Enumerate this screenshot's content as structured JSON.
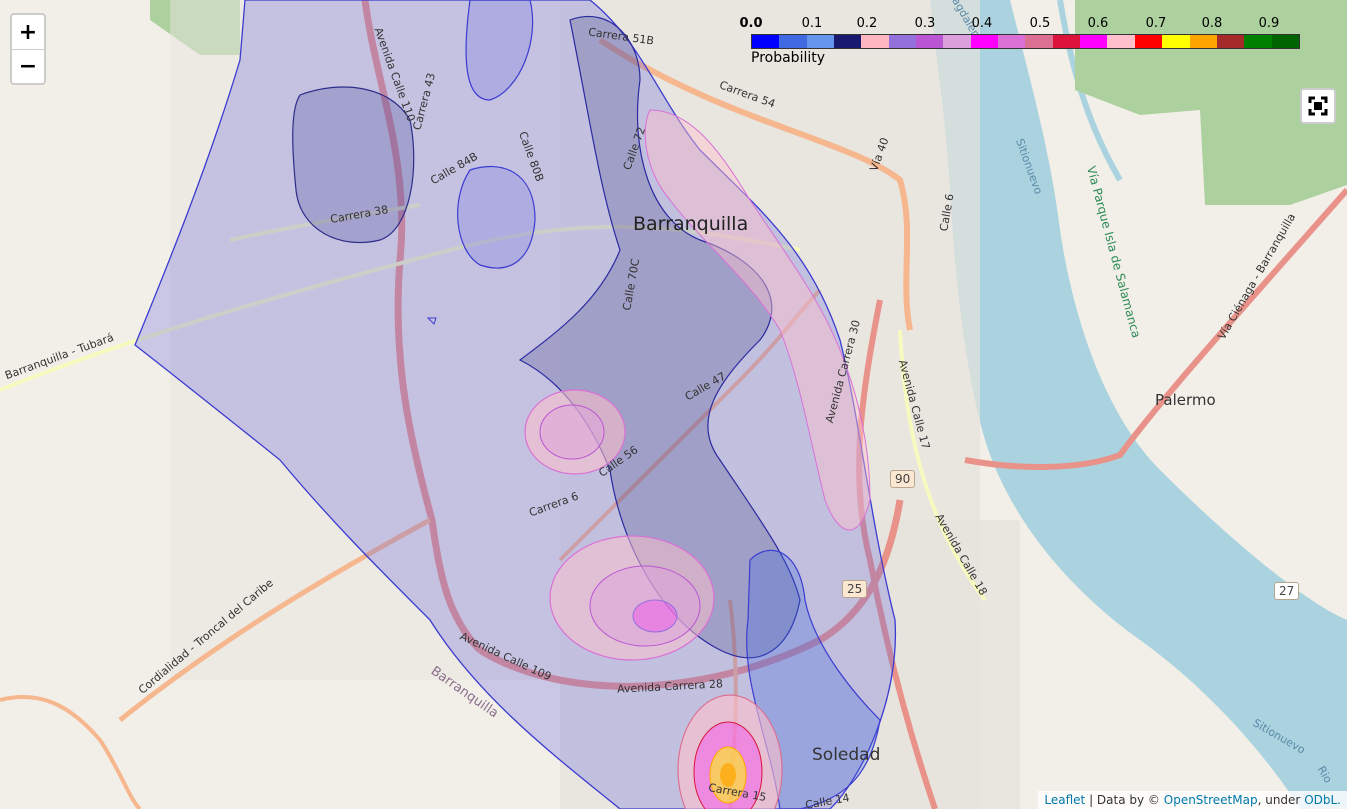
{
  "controls": {
    "zoom_in": "+",
    "zoom_out": "−",
    "fullscreen_icon": "fullscreen-icon"
  },
  "legend": {
    "ticks": [
      "0.0",
      "0.1",
      "0.2",
      "0.3",
      "0.4",
      "0.5",
      "0.6",
      "0.7",
      "0.8",
      "0.9"
    ],
    "caption": "Probability",
    "colors": [
      "#0000ff",
      "#4169e1",
      "#6495ed",
      "#191970",
      "#ffb6c1",
      "#9370db",
      "#ba55d3",
      "#dda0dd",
      "#ff00ff",
      "#da70d6",
      "#db7093",
      "#dc143c",
      "#ff00ff",
      "#ffc0cb",
      "#ff0000",
      "#ffff00",
      "#ffa500",
      "#a52a2a",
      "#008000",
      "#006400"
    ]
  },
  "labels": {
    "city": "Barranquilla",
    "palermo": "Palermo",
    "soledad": "Soledad",
    "roads": {
      "carrera51b": "Carrera 51B",
      "carrera54": "Carrera 54",
      "calle72": "Calle 72",
      "calle84b": "Calle 84B",
      "calle80b": "Calle 80B",
      "carrera38": "Carrera 38",
      "av_calle110": "Avenida Calle 110",
      "carrera43": "Carrera 43",
      "calle70c": "Calle 70C",
      "calle47": "Calle 47",
      "calle56": "Calle 56",
      "carrera6": "Carrera 6",
      "via40": "Vía 40",
      "calle6": "Calle 6",
      "av_carrera30": "Avenida Carrera 30",
      "av_calle17": "Avenida Calle 17",
      "av_calle18": "Avenida Calle 18",
      "av_calle109": "Avenida Calle 109",
      "av_carrera28": "Avenida Carrera 28",
      "carrera15": "Carrera 15",
      "calle14": "Calle 14",
      "barranquilla_tubara": "Barranquilla - Tubará",
      "cordialidad": "Cordialidad - Troncal del Caribe",
      "barranquilla_sw": "Barranquilla",
      "via_parque": "Vía Parque Isla de Salamanca",
      "via_cienaga": "Vía Ciénaga - Barranquilla",
      "sitionuevo": "Sitionuevo",
      "sitionuevo2": "Sitionuevo",
      "magdalena": "Magdalena",
      "rio": "Rio"
    },
    "shields": {
      "r90": "90",
      "r25": "25",
      "r27": "27"
    }
  },
  "attribution": {
    "leaflet": "Leaflet",
    "sep": " | Data by © ",
    "osm": "OpenStreetMap",
    "under": ", under ",
    "odbl": "ODbL."
  }
}
